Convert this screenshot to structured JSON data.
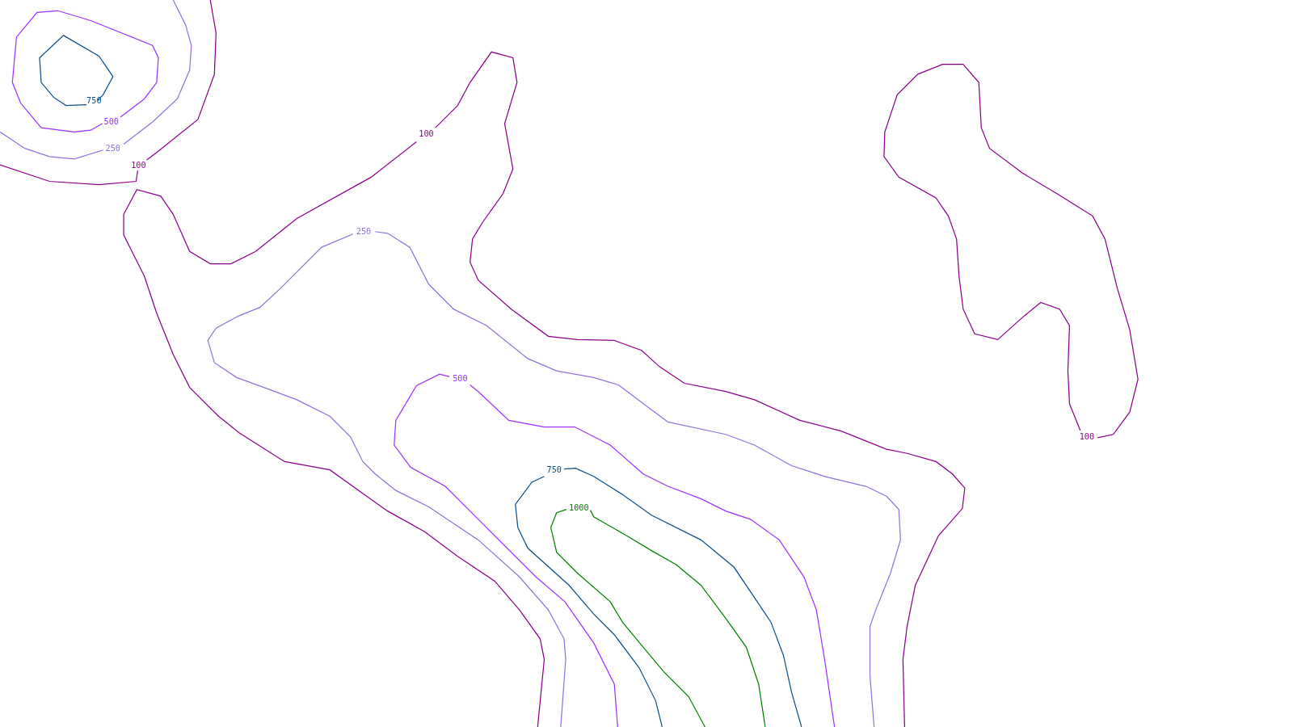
{
  "contours": [
    {
      "label": "750",
      "color": "#0b4f8a"
    },
    {
      "label": "500",
      "color": "#9b30ff"
    },
    {
      "label": "250",
      "color": "#9370db"
    },
    {
      "label": "100",
      "color": "#8b008b"
    },
    {
      "label": "100",
      "color": "#8b008b"
    },
    {
      "label": "250",
      "color": "#9370db"
    },
    {
      "label": "500",
      "color": "#9b30ff"
    },
    {
      "label": "750",
      "color": "#0b4f8a"
    },
    {
      "label": "1000",
      "color": "#008000"
    },
    {
      "label": "100",
      "color": "#8b008b"
    }
  ]
}
